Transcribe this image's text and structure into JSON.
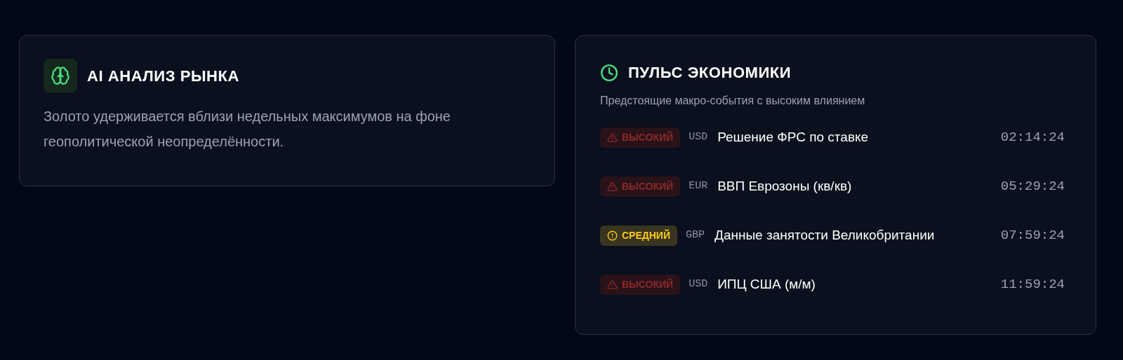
{
  "ai_analysis": {
    "title": "AI АНАЛИЗ РЫНКА",
    "text": "Золото удерживается вблизи недельных максимумов на фоне геополитической неопределённости."
  },
  "economic_pulse": {
    "title": "ПУЛЬС ЭКОНОМИКИ",
    "subtitle": "Предстоящие макро-события с высоким влиянием",
    "events": [
      {
        "impact": {
          "kind": "high",
          "label": "ВЫСОКИЙ"
        },
        "currency": "USD",
        "name": "Решение ФРС по ставке",
        "countdown": "02:14:24"
      },
      {
        "impact": {
          "kind": "high",
          "label": "ВЫСОКИЙ"
        },
        "currency": "EUR",
        "name": "ВВП Еврозоны (кв/кв)",
        "countdown": "05:29:24"
      },
      {
        "impact": {
          "kind": "medium",
          "label": "СРЕДНИЙ"
        },
        "currency": "GBP",
        "name": "Данные занятости Великобритании",
        "countdown": "07:59:24"
      },
      {
        "impact": {
          "kind": "high",
          "label": "ВЫСОКИЙ"
        },
        "currency": "USD",
        "name": "ИПЦ США (м/м)",
        "countdown": "11:59:24"
      }
    ]
  }
}
